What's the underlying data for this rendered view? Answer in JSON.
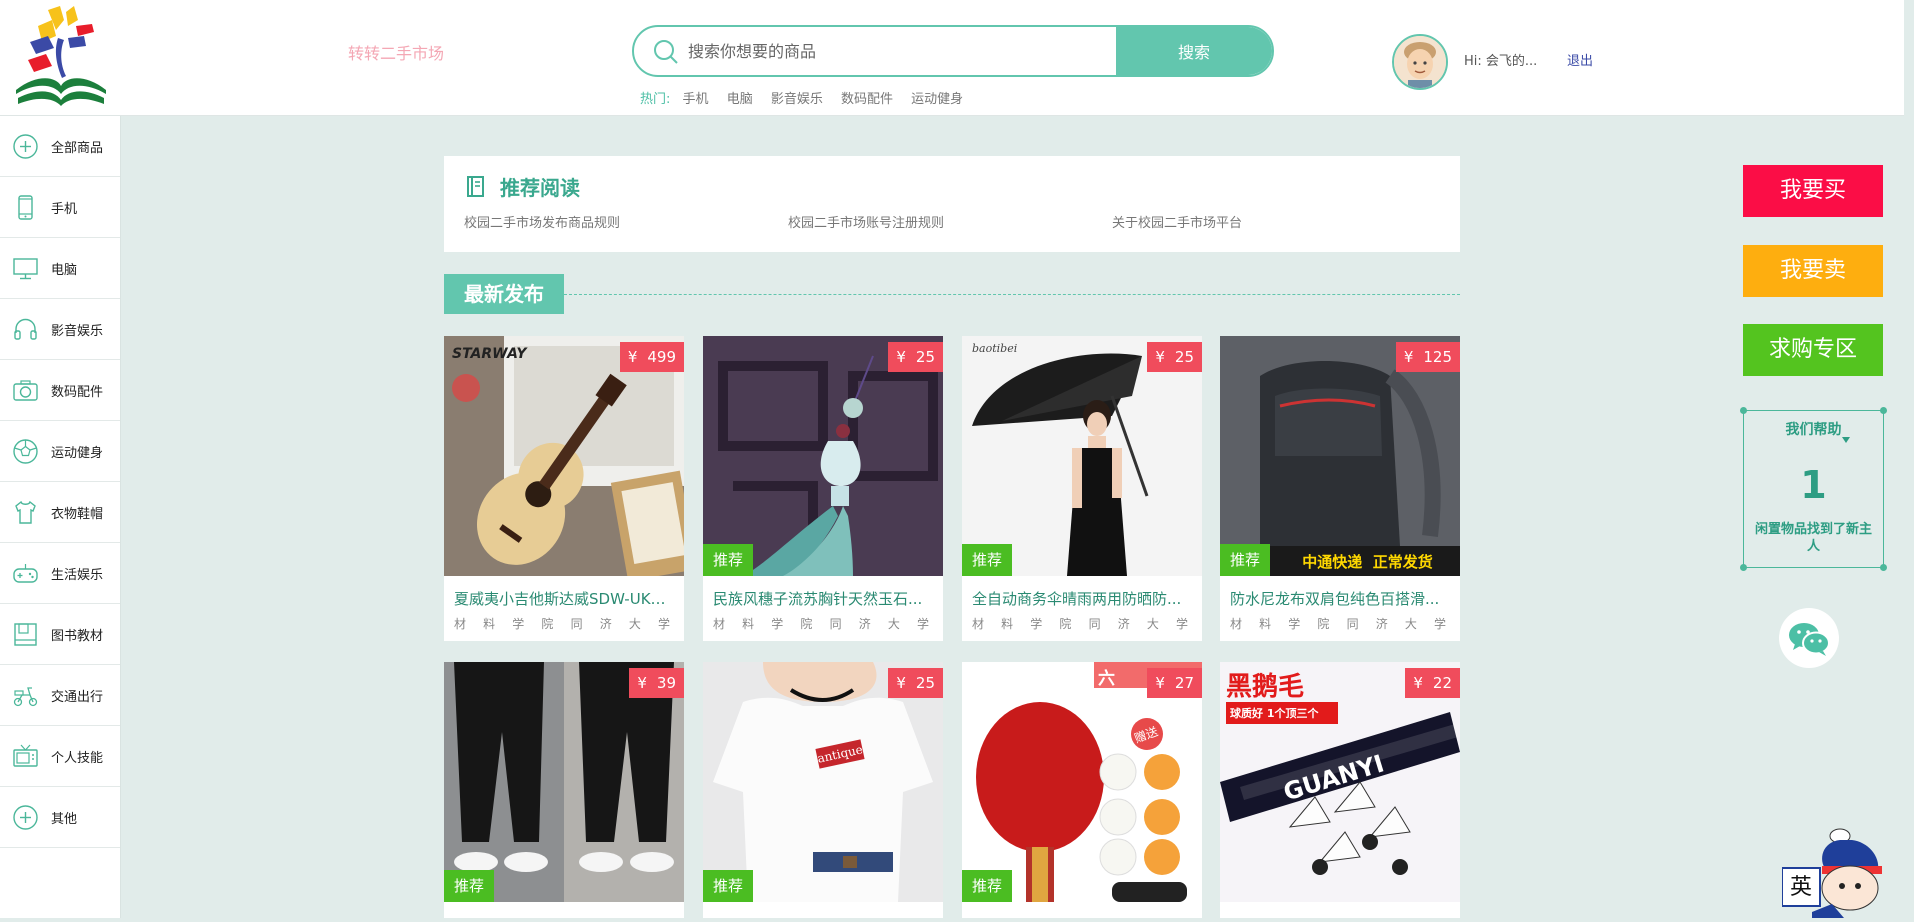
{
  "header": {
    "site_name": "转转二手市场",
    "search": {
      "placeholder": "搜索你想要的商品",
      "button_label": "搜索"
    },
    "hot": {
      "label": "热门:",
      "links": [
        "手机",
        "电脑",
        "影音娱乐",
        "数码配件",
        "运动健身"
      ]
    },
    "user": {
      "greeting": "Hi: 会飞的...",
      "logout_label": "退出"
    }
  },
  "sidebar": {
    "items": [
      {
        "label": "全部商品",
        "icon": "plus-circle-icon"
      },
      {
        "label": "手机",
        "icon": "phone-icon"
      },
      {
        "label": "电脑",
        "icon": "monitor-icon"
      },
      {
        "label": "影音娱乐",
        "icon": "headphones-icon"
      },
      {
        "label": "数码配件",
        "icon": "camera-icon"
      },
      {
        "label": "运动健身",
        "icon": "football-icon"
      },
      {
        "label": "衣物鞋帽",
        "icon": "shirt-icon"
      },
      {
        "label": "生活娱乐",
        "icon": "gamepad-icon"
      },
      {
        "label": "图书教材",
        "icon": "book-icon"
      },
      {
        "label": "交通出行",
        "icon": "scooter-icon"
      },
      {
        "label": "个人技能",
        "icon": "tv-icon"
      },
      {
        "label": "其他",
        "icon": "plus-circle-icon"
      }
    ]
  },
  "reading": {
    "title": "推荐阅读",
    "links": [
      "校园二手市场发布商品规则",
      "校园二手市场账号注册规则",
      "关于校园二手市场平台"
    ]
  },
  "latest": {
    "title": "最新发布",
    "recommend_label": "推荐",
    "currency": "¥",
    "products": [
      {
        "title": "夏威夷小吉他斯达威SDW-UK2...",
        "price": "499",
        "school": [
          "材",
          "料",
          "学",
          "院",
          "同",
          "济",
          "大",
          "学"
        ],
        "image": "ukulele"
      },
      {
        "title": "民族风穗子流苏胸针天然玉石...",
        "price": "25",
        "school": [
          "材",
          "料",
          "学",
          "院",
          "同",
          "济",
          "大",
          "学"
        ],
        "image": "tassel"
      },
      {
        "title": "全自动商务伞晴雨两用防晒防...",
        "price": "25",
        "school": [
          "材",
          "料",
          "学",
          "院",
          "同",
          "济",
          "大",
          "学"
        ],
        "image": "umbrella"
      },
      {
        "title": "防水尼龙布双肩包纯色百搭滑...",
        "price": "125",
        "school": [
          "材",
          "料",
          "学",
          "院",
          "同",
          "济",
          "大",
          "学"
        ],
        "image": "backpack",
        "banner": "中通快递  正常发货"
      },
      {
        "title": "",
        "price": "39",
        "school": [],
        "image": "pants"
      },
      {
        "title": "",
        "price": "25",
        "school": [],
        "image": "tshirt",
        "tag": "antique"
      },
      {
        "title": "",
        "price": "27",
        "school": [],
        "image": "pingpong",
        "tag": "六",
        "extra": "赠送"
      },
      {
        "title": "",
        "price": "22",
        "school": [],
        "image": "shuttlecock",
        "tag": "黑鹅毛",
        "subtag": "球质好 1个顶三个",
        "brand": "GUANYI"
      }
    ]
  },
  "right_panel": {
    "buy_label": "我要买",
    "sell_label": "我要卖",
    "wanted_label": "求购专区",
    "help_title": "我们帮助",
    "help_count": "1",
    "help_desc": "闲置物品找到了新主人",
    "colors": {
      "buy": "#fb0d46",
      "sell": "#feae0f",
      "wanted": "#54c41f"
    }
  },
  "mascot": {
    "ime_label": "英"
  }
}
